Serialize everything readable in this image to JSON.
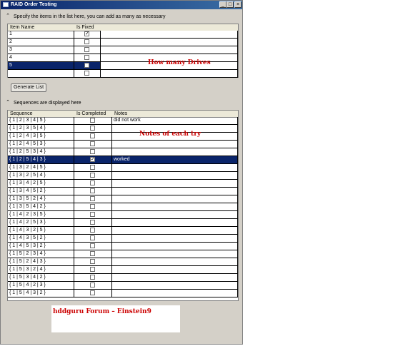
{
  "window": {
    "title": "RAID Order Testing",
    "minimize": "_",
    "maximize": "□",
    "close": "×"
  },
  "items_section": {
    "header": "Specify the items in the list here, you can add as many as necessary",
    "columns": [
      "Item Name",
      "Is Fixed"
    ],
    "rows": [
      {
        "name": "1",
        "fixed": true
      },
      {
        "name": "2",
        "fixed": false
      },
      {
        "name": "3",
        "fixed": false
      },
      {
        "name": "4",
        "fixed": false
      },
      {
        "name": "5",
        "fixed": false,
        "selected": true
      },
      {
        "name": "",
        "fixed": false
      }
    ]
  },
  "generate_button": "Generate List",
  "sequences_section": {
    "header": "Sequences are displayed here",
    "columns": [
      "Sequence",
      "Is Completed",
      "Notes"
    ],
    "rows": [
      {
        "seq": "{ 1 | 2 | 3 | 4 | 5 }",
        "done": false,
        "notes": "did not work"
      },
      {
        "seq": "{ 1 | 2 | 3 | 5 | 4 }",
        "done": false,
        "notes": ""
      },
      {
        "seq": "{ 1 | 2 | 4 | 3 | 5 }",
        "done": false,
        "notes": ""
      },
      {
        "seq": "{ 1 | 2 | 4 | 5 | 3 }",
        "done": false,
        "notes": ""
      },
      {
        "seq": "{ 1 | 2 | 5 | 3 | 4 }",
        "done": false,
        "notes": ""
      },
      {
        "seq": "{ 1 | 2 | 5 | 4 | 3 }",
        "done": true,
        "notes": "worked",
        "selected": true
      },
      {
        "seq": "{ 1 | 3 | 2 | 4 | 5 }",
        "done": false,
        "notes": ""
      },
      {
        "seq": "{ 1 | 3 | 2 | 5 | 4 }",
        "done": false,
        "notes": ""
      },
      {
        "seq": "{ 1 | 3 | 4 | 2 | 5 }",
        "done": false,
        "notes": ""
      },
      {
        "seq": "{ 1 | 3 | 4 | 5 | 2 }",
        "done": false,
        "notes": ""
      },
      {
        "seq": "{ 1 | 3 | 5 | 2 | 4 }",
        "done": false,
        "notes": ""
      },
      {
        "seq": "{ 1 | 3 | 5 | 4 | 2 }",
        "done": false,
        "notes": ""
      },
      {
        "seq": "{ 1 | 4 | 2 | 3 | 5 }",
        "done": false,
        "notes": ""
      },
      {
        "seq": "{ 1 | 4 | 2 | 5 | 3 }",
        "done": false,
        "notes": ""
      },
      {
        "seq": "{ 1 | 4 | 3 | 2 | 5 }",
        "done": false,
        "notes": ""
      },
      {
        "seq": "{ 1 | 4 | 3 | 5 | 2 }",
        "done": false,
        "notes": ""
      },
      {
        "seq": "{ 1 | 4 | 5 | 3 | 2 }",
        "done": false,
        "notes": ""
      },
      {
        "seq": "{ 1 | 5 | 2 | 3 | 4 }",
        "done": false,
        "notes": ""
      },
      {
        "seq": "{ 1 | 5 | 2 | 4 | 3 }",
        "done": false,
        "notes": ""
      },
      {
        "seq": "{ 1 | 5 | 3 | 2 | 4 }",
        "done": false,
        "notes": ""
      },
      {
        "seq": "{ 1 | 5 | 3 | 4 | 2 }",
        "done": false,
        "notes": ""
      },
      {
        "seq": "{ 1 | 5 | 4 | 2 | 3 }",
        "done": false,
        "notes": ""
      },
      {
        "seq": "{ 1 | 5 | 4 | 3 | 2 }",
        "done": false,
        "notes": ""
      }
    ]
  },
  "annotations": {
    "drives": "How many Drives",
    "notes": "Notes of each try",
    "forum": "hddguru Forum – Einstein9"
  },
  "colors": {
    "selection": "#0a246a",
    "annotation": "#cc0000"
  }
}
